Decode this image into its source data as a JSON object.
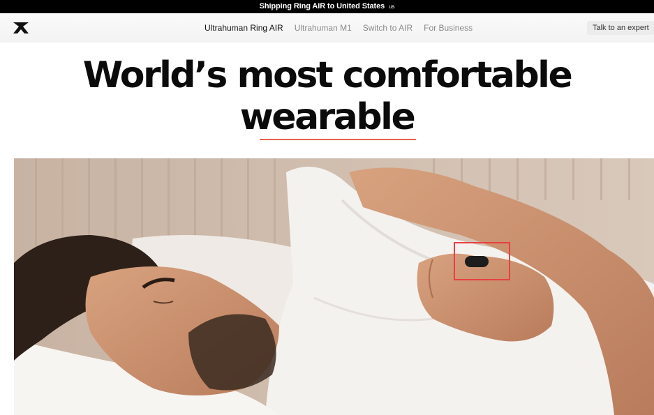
{
  "announcement": {
    "text": "Shipping Ring AIR to United States",
    "country": "us"
  },
  "nav": {
    "items": [
      {
        "label": "Ultrahuman Ring AIR",
        "active": true
      },
      {
        "label": "Ultrahuman M1",
        "active": false
      },
      {
        "label": "Switch to AIR",
        "active": false
      },
      {
        "label": "For Business",
        "active": false
      }
    ],
    "cta_label": "Talk to an expert",
    "logo_icon": "ultrahuman-logo-icon"
  },
  "hero": {
    "title_line1": "World’s most comfortable",
    "title_line2": "wearable",
    "accent_color": "#e8604c",
    "image_icon": "sleeping-man-wearing-ring-photo"
  }
}
